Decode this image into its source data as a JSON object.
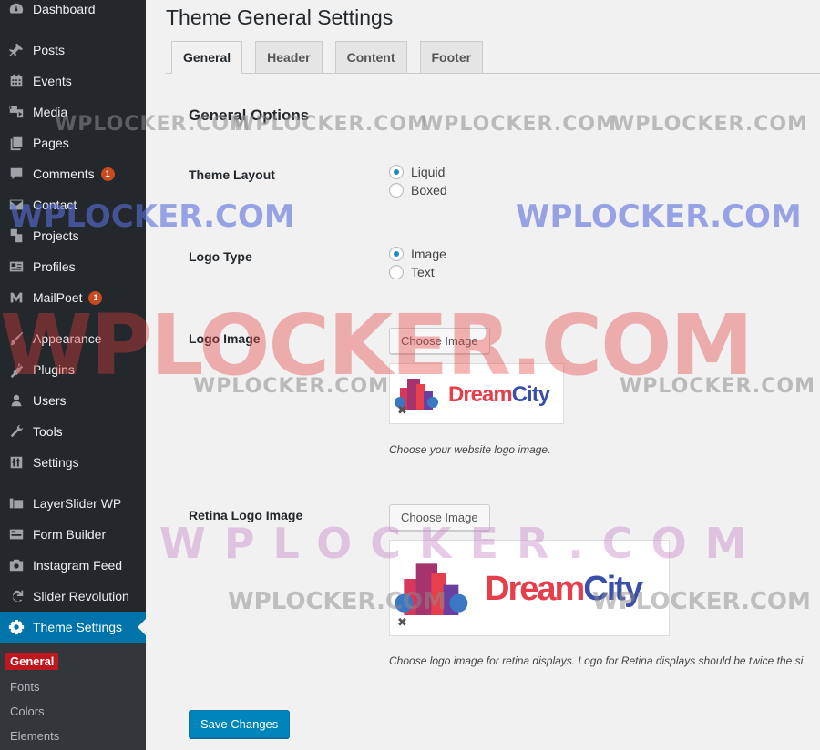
{
  "sidebar": {
    "items": [
      {
        "label": "Dashboard",
        "icon": "dashboard-icon"
      },
      {
        "label": "Posts",
        "icon": "pin-icon"
      },
      {
        "label": "Events",
        "icon": "calendar-icon"
      },
      {
        "label": "Media",
        "icon": "media-icon"
      },
      {
        "label": "Pages",
        "icon": "pages-icon"
      },
      {
        "label": "Comments",
        "icon": "comment-icon",
        "badge": "1"
      },
      {
        "label": "Contact",
        "icon": "mail-icon"
      },
      {
        "label": "Projects",
        "icon": "portfolio-icon"
      },
      {
        "label": "Profiles",
        "icon": "id-card-icon"
      },
      {
        "label": "MailPoet",
        "icon": "mailpoet-icon",
        "badge": "1"
      },
      {
        "label": "Appearance",
        "icon": "brush-icon"
      },
      {
        "label": "Plugins",
        "icon": "plugin-icon"
      },
      {
        "label": "Users",
        "icon": "user-icon"
      },
      {
        "label": "Tools",
        "icon": "wrench-icon"
      },
      {
        "label": "Settings",
        "icon": "settings-sliders-icon"
      },
      {
        "label": "LayerSlider WP",
        "icon": "layers-icon"
      },
      {
        "label": "Form Builder",
        "icon": "form-icon"
      },
      {
        "label": "Instagram Feed",
        "icon": "camera-icon"
      },
      {
        "label": "Slider Revolution",
        "icon": "refresh-icon"
      },
      {
        "label": "Theme Settings",
        "icon": "gear-icon",
        "active": true
      }
    ],
    "submenu": [
      "General",
      "Fonts",
      "Colors",
      "Elements"
    ]
  },
  "page": {
    "title": "Theme General Settings",
    "tabs": [
      "General",
      "Header",
      "Content",
      "Footer"
    ],
    "section_title": "General Options"
  },
  "fields": {
    "theme_layout": {
      "label": "Theme Layout",
      "options": [
        "Liquid",
        "Boxed"
      ],
      "selected": "Liquid"
    },
    "logo_type": {
      "label": "Logo Type",
      "options": [
        "Image",
        "Text"
      ],
      "selected": "Image"
    },
    "logo_image": {
      "label": "Logo Image",
      "button": "Choose Image",
      "logo_text_1": "Dream",
      "logo_text_2": "City",
      "remove": "✖",
      "description": "Choose your website logo image."
    },
    "retina_logo_image": {
      "label": "Retina Logo Image",
      "button": "Choose Image",
      "logo_text_1": "Dream",
      "logo_text_2": "City",
      "remove": "✖",
      "description": "Choose logo image for retina displays. Logo for Retina displays should be twice the si"
    }
  },
  "save_button": "Save Changes",
  "watermark": "WPLOCKER.COM"
}
